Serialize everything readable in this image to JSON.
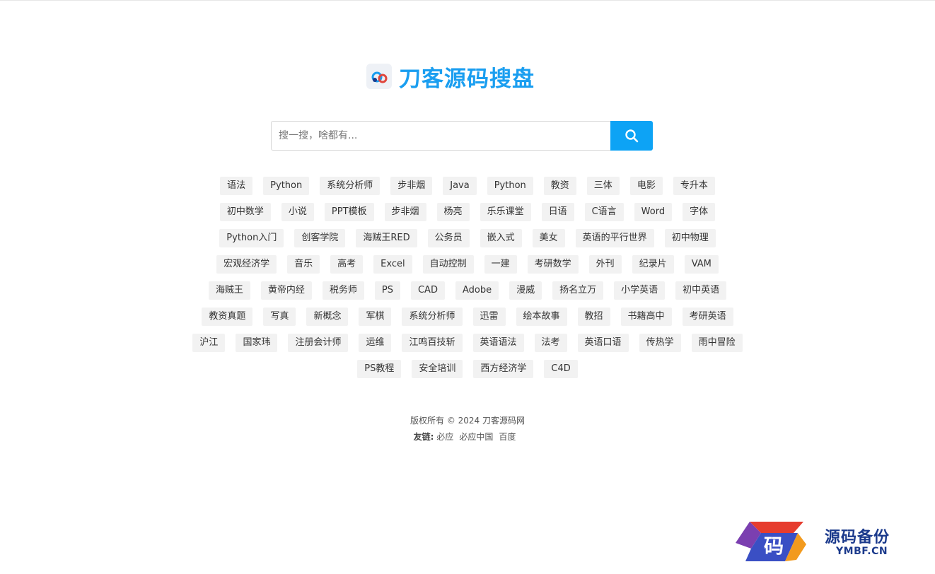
{
  "brand": {
    "name": "刀客源码搜盘",
    "accent_color": "#1a9ef0",
    "icon": "cloud-link-icon"
  },
  "search": {
    "placeholder": "搜一搜，啥都有...",
    "value": "",
    "button_icon": "search-icon",
    "button_color": "#0da3f5"
  },
  "tags": [
    [
      "语法",
      "Python",
      "系统分析师",
      "步非烟",
      "Java",
      "Python",
      "教资",
      "三体",
      "电影",
      "专升本"
    ],
    [
      "初中数学",
      "小说",
      "PPT模板",
      "步非烟",
      "杨亮",
      "乐乐课堂",
      "日语",
      "C语言",
      "Word",
      "字体"
    ],
    [
      "Python入门",
      "创客学院",
      "海贼王RED",
      "公务员",
      "嵌入式",
      "美女",
      "英语的平行世界",
      "初中物理"
    ],
    [
      "宏观经济学",
      "音乐",
      "高考",
      "Excel",
      "自动控制",
      "一建",
      "考研数学",
      "外刊",
      "纪录片",
      "VAM"
    ],
    [
      "海贼王",
      "黄帝内经",
      "税务师",
      "PS",
      "CAD",
      "Adobe",
      "漫威",
      "扬名立万",
      "小学英语",
      "初中英语"
    ],
    [
      "教资真题",
      "写真",
      "新概念",
      "军棋",
      "系统分析师",
      "迅雷",
      "绘本故事",
      "教招",
      "书籍高中",
      "考研英语"
    ],
    [
      "沪江",
      "国家玮",
      "注册会计师",
      "运维",
      "江鸣百技斩",
      "英语语法",
      "法考",
      "英语口语",
      "传热学",
      "雨中冒险"
    ],
    [
      "PS教程",
      "安全培训",
      "西方经济学",
      "C4D"
    ]
  ],
  "footer": {
    "copyright": "版权所有 © 2024 刀客源码网",
    "friend_label": "友链:",
    "links": [
      "必应",
      "必应中国",
      "百度"
    ]
  },
  "watermark": {
    "glyph": "码",
    "title": "源码备份",
    "subtitle": "YMBF.CN"
  }
}
